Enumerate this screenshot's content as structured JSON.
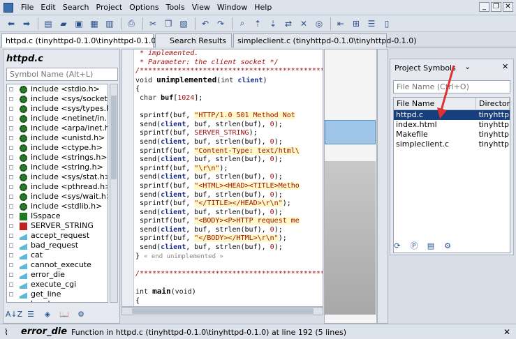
{
  "menubar": {
    "items": [
      "File",
      "Edit",
      "Search",
      "Project",
      "Options",
      "Tools",
      "View",
      "Window",
      "Help"
    ]
  },
  "tabs": [
    {
      "label": "httpd.c (tinyhttpd-0.1.0\\tinyhttpd-0.1.0)"
    },
    {
      "label": "Search Results"
    },
    {
      "label": "simpleclient.c (tinyhttpd-0.1.0\\tinyhttpd-0.1.0)"
    }
  ],
  "symbols_panel": {
    "title": "httpd.c",
    "placeholder": "Symbol Name (Alt+L)",
    "items": [
      {
        "label": "include <stdio.h>",
        "kind": "include"
      },
      {
        "label": "include <sys/socket.h>",
        "kind": "include"
      },
      {
        "label": "include <sys/types.h>",
        "kind": "include"
      },
      {
        "label": "include <netinet/in.h>",
        "kind": "include"
      },
      {
        "label": "include <arpa/inet.h>",
        "kind": "include"
      },
      {
        "label": "include <unistd.h>",
        "kind": "include"
      },
      {
        "label": "include <ctype.h>",
        "kind": "include"
      },
      {
        "label": "include <strings.h>",
        "kind": "include"
      },
      {
        "label": "include <string.h>",
        "kind": "include"
      },
      {
        "label": "include <sys/stat.h>",
        "kind": "include"
      },
      {
        "label": "include <pthread.h>",
        "kind": "include"
      },
      {
        "label": "include <sys/wait.h>",
        "kind": "include"
      },
      {
        "label": "include <stdlib.h>",
        "kind": "include"
      },
      {
        "label": "ISspace",
        "kind": "define"
      },
      {
        "label": "SERVER_STRING",
        "kind": "string"
      },
      {
        "label": "accept_request",
        "kind": "function"
      },
      {
        "label": "bad_request",
        "kind": "function"
      },
      {
        "label": "cat",
        "kind": "function"
      },
      {
        "label": "cannot_execute",
        "kind": "function"
      },
      {
        "label": "error_die",
        "kind": "function"
      },
      {
        "label": "execute_cgi",
        "kind": "function"
      },
      {
        "label": "get_line",
        "kind": "function"
      },
      {
        "label": "headers",
        "kind": "function"
      }
    ]
  },
  "project_panel": {
    "title": "Project Symbols",
    "placeholder": "File Name (Ctrl+O)",
    "columns": [
      "File Name",
      "Director"
    ],
    "rows": [
      {
        "name": "httpd.c",
        "dir": "tinyhttp",
        "selected": true
      },
      {
        "name": "index.html",
        "dir": "tinyhttp",
        "selected": false
      },
      {
        "name": "Makefile",
        "dir": "tinyhttp",
        "selected": false
      },
      {
        "name": "simpleclient.c",
        "dir": "tinyhttp",
        "selected": false
      }
    ]
  },
  "status": {
    "symbol": "error_die",
    "description": "Function in httpd.c (tinyhttpd-0.1.0\\tinyhttpd-0.1.0) at line 192 (5 lines)"
  },
  "colors": {
    "selection": "#173f7e",
    "annotation_arrow": "#e03030"
  }
}
